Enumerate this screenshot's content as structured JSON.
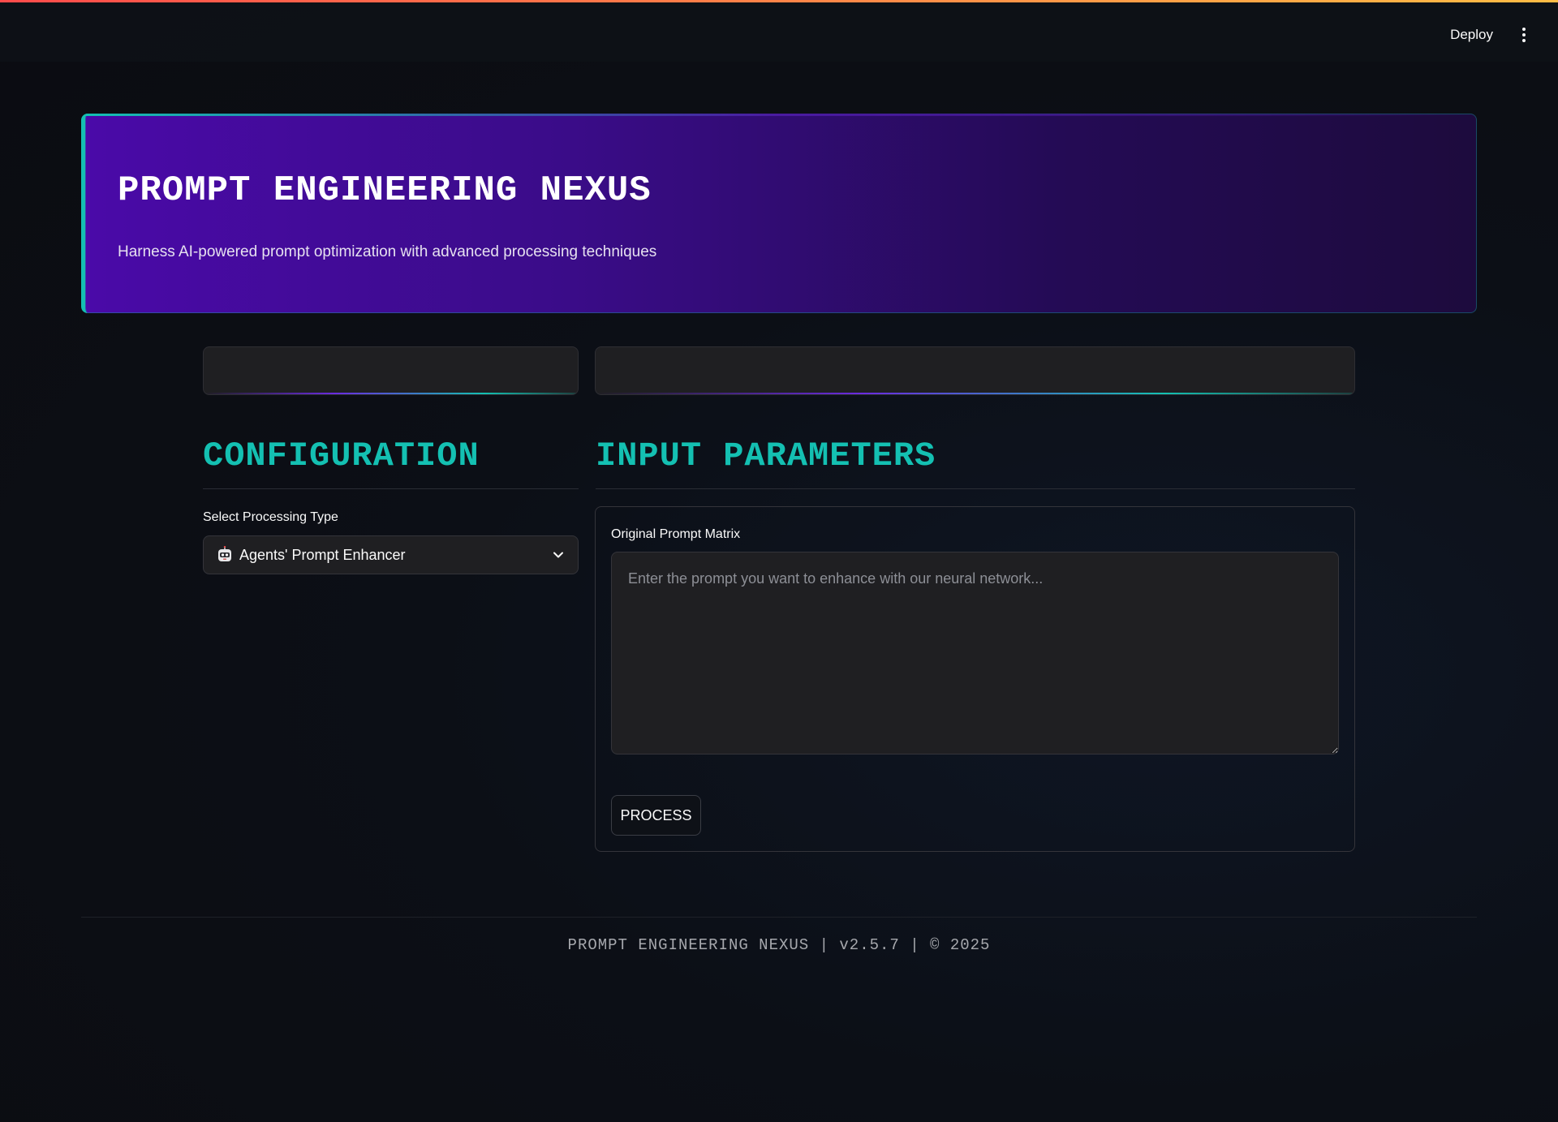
{
  "toolbar": {
    "deploy_label": "Deploy",
    "menu_icon": "vertical-ellipsis-icon",
    "accent_line_colors": [
      "#ff4b4b",
      "#ffbd45"
    ]
  },
  "header": {
    "title": "PROMPT ENGINEERING NEXUS",
    "subtitle": "Harness AI-powered prompt optimization with advanced processing techniques"
  },
  "configuration": {
    "heading": "CONFIGURATION",
    "select_label": "Select Processing Type",
    "select_icon": "robot-face-icon",
    "selected_value": "Agents' Prompt Enhancer"
  },
  "input_parameters": {
    "heading": "INPUT PARAMETERS",
    "prompt_label": "Original Prompt Matrix",
    "prompt_placeholder": "Enter the prompt you want to enhance with our neural network...",
    "prompt_value": "",
    "process_button": "PROCESS"
  },
  "footer": {
    "text": "PROMPT ENGINEERING NEXUS | v2.5.7 | © 2025"
  },
  "colors": {
    "accent_teal": "#14c0b2",
    "hero_purple": "#4a0aa8",
    "background": "#0e1117"
  }
}
